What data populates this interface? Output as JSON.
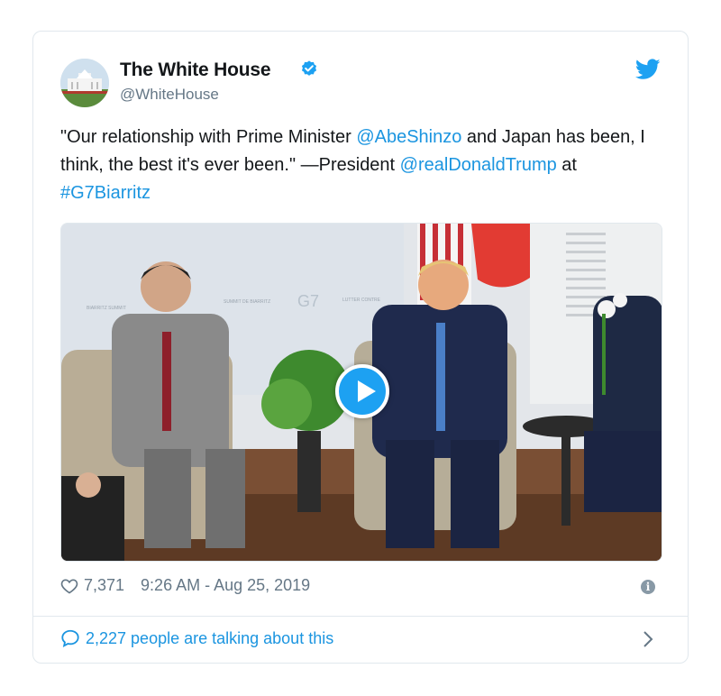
{
  "tweet": {
    "author_name": "The White House",
    "author_handle": "@WhiteHouse",
    "text_parts": {
      "p1": "\"Our relationship with Prime Minister ",
      "mention1": "@AbeShinzo",
      "p2": " and Japan has been, I think, the best it's ever been.\" —President ",
      "mention2": "@realDonaldTrump",
      "p3": " at ",
      "hashtag": "#G7Biarritz"
    },
    "likes": "7,371",
    "timestamp": "9:26 AM - Aug 25, 2019",
    "talking": "2,227 people are talking about this"
  },
  "icons": {
    "verified": "verified-badge-icon",
    "bird": "twitter-bird-icon",
    "heart": "heart-icon",
    "info": "info-icon",
    "bubble": "speech-bubble-icon",
    "chevron": "chevron-right-icon",
    "play": "play-icon"
  },
  "colors": {
    "accent": "#1da1f2",
    "link": "#1b95e0",
    "muted": "#657786",
    "border": "#e1e8ed"
  }
}
